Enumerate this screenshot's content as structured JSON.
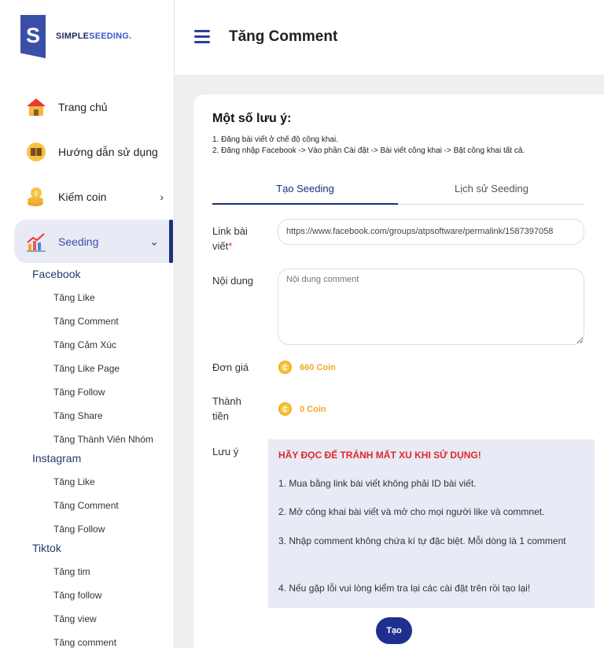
{
  "brand": {
    "logo_letter": "S",
    "part1": "SIMPLE",
    "part2": "SEEDING."
  },
  "sidebar": {
    "items": [
      {
        "label": "Trang chủ",
        "icon": "home-icon"
      },
      {
        "label": "Hướng dẫn sử dụng",
        "icon": "book-icon"
      },
      {
        "label": "Kiếm coin",
        "icon": "coins-icon",
        "arrow": "›"
      },
      {
        "label": "Seeding",
        "icon": "chart-icon",
        "arrow": "⌄",
        "active": true
      }
    ],
    "groups": [
      {
        "title": "Facebook",
        "items": [
          "Tăng Like",
          "Tăng Comment",
          "Tăng Cảm Xúc",
          "Tăng Like Page",
          "Tăng Follow",
          "Tăng Share",
          "Tăng Thành Viên Nhóm"
        ]
      },
      {
        "title": "Instagram",
        "items": [
          "Tăng Like",
          "Tăng Comment",
          "Tăng Follow"
        ]
      },
      {
        "title": "Tiktok",
        "items": [
          "Tăng tim",
          "Tăng follow",
          "Tăng view",
          "Tăng comment"
        ]
      }
    ]
  },
  "header": {
    "title": "Tăng Comment"
  },
  "notes": {
    "title": "Một số lưu ý:",
    "lines": [
      "1. Đăng bài viết ở chế độ công khai.",
      "2. Đăng nhập Facebook -> Vào phần Cài đặt -> Bài viết công khai -> Bật công khai tất cả."
    ]
  },
  "tabs": [
    "Tạo Seeding",
    "Lịch sử Seeding"
  ],
  "form": {
    "link_label_1": "Link bài",
    "link_label_2": "viết",
    "required_mark": "*",
    "link_value": "https://www.facebook.com/groups/atpsoftware/permalink/1587397058",
    "content_label": "Nội dung",
    "content_placeholder": "Nội dung comment",
    "price_label": "Đơn giá",
    "price_value": "660 Coin",
    "total_label_1": "Thành",
    "total_label_2": "tiền",
    "total_value": "0 Coin",
    "notice_label": "Lưu ý",
    "coin_symbol": "₵"
  },
  "notice": {
    "warning": "HÃY ĐỌC ĐỂ TRÁNH MẤT XU KHI SỬ DỤNG!",
    "items": [
      "1. Mua bằng link bài viết không phải ID bài viết.",
      "2. Mở công khai bài viết và mở cho mọi người like và commnet.",
      "3. Nhập comment không chứa kí tự đặc biệt. Mỗi dòng là 1 comment",
      "4. Nếu gặp lỗi vui lòng kiểm tra lại các cài đặt trên rồi tạo lại!"
    ]
  },
  "button": {
    "create": "Tạo"
  },
  "colors": {
    "primary": "#1f2f8f",
    "accent": "#3a4fa8",
    "coin": "#f5a623",
    "warning": "#e02828"
  }
}
